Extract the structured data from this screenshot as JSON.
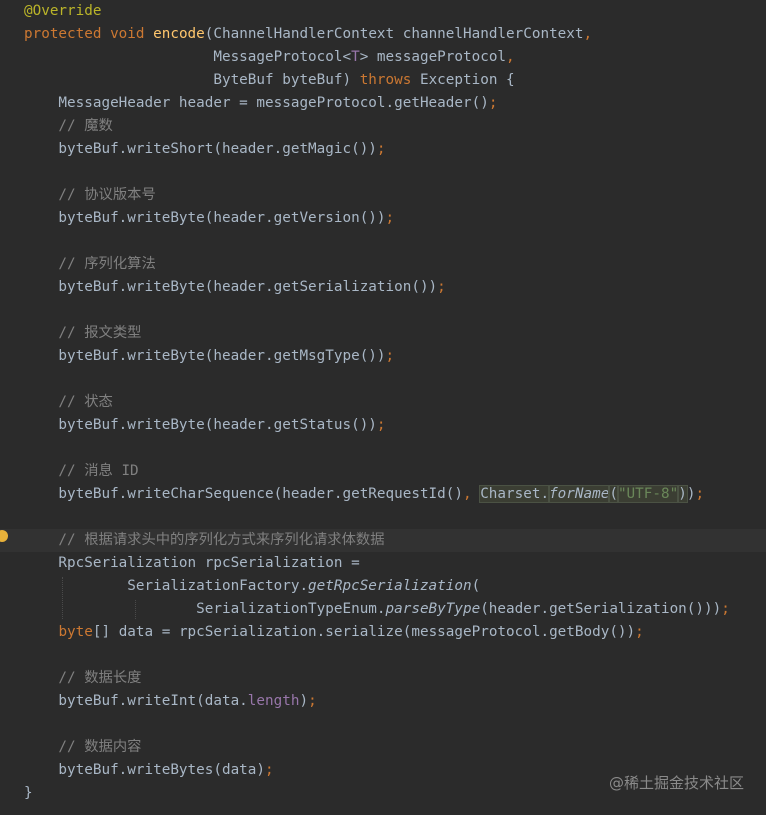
{
  "theme": {
    "background": "#2b2b2b",
    "text": "#a9b7c6",
    "keyword": "#cc7832",
    "annotation": "#bbb529",
    "method": "#ffc66d",
    "comment": "#808080",
    "string": "#6a8759",
    "field": "#9876aa"
  },
  "code_lines": [
    [
      {
        "text": "@Override",
        "cls": "ann"
      }
    ],
    [
      {
        "text": "protected ",
        "cls": "kw"
      },
      {
        "text": "void ",
        "cls": "kw"
      },
      {
        "text": "encode",
        "cls": "fn"
      },
      {
        "text": "(ChannelHandlerContext channelHandlerContext"
      },
      {
        "text": ",",
        "cls": "kw"
      }
    ],
    [
      {
        "text": "                      MessageProtocol<"
      },
      {
        "text": "T",
        "cls": "field"
      },
      {
        "text": "> messageProtocol"
      },
      {
        "text": ",",
        "cls": "kw"
      }
    ],
    [
      {
        "text": "                      ByteBuf byteBuf) "
      },
      {
        "text": "throws ",
        "cls": "kw"
      },
      {
        "text": "Exception {"
      }
    ],
    [
      {
        "text": "    MessageHeader header = messageProtocol.getHeader()"
      },
      {
        "text": ";",
        "cls": "kw"
      }
    ],
    [
      {
        "text": "    // 魔数",
        "cls": "cm"
      }
    ],
    [
      {
        "text": "    byteBuf.writeShort(header.getMagic())"
      },
      {
        "text": ";",
        "cls": "kw"
      }
    ],
    [],
    [
      {
        "text": "    // 协议版本号",
        "cls": "cm"
      }
    ],
    [
      {
        "text": "    byteBuf.writeByte(header.getVersion())"
      },
      {
        "text": ";",
        "cls": "kw"
      }
    ],
    [],
    [
      {
        "text": "    // 序列化算法",
        "cls": "cm"
      }
    ],
    [
      {
        "text": "    byteBuf.writeByte(header.getSerialization())"
      },
      {
        "text": ";",
        "cls": "kw"
      }
    ],
    [],
    [
      {
        "text": "    // 报文类型",
        "cls": "cm"
      }
    ],
    [
      {
        "text": "    byteBuf.writeByte(header.getMsgType())"
      },
      {
        "text": ";",
        "cls": "kw"
      }
    ],
    [],
    [
      {
        "text": "    // 状态",
        "cls": "cm"
      }
    ],
    [
      {
        "text": "    byteBuf.writeByte(header.getStatus())"
      },
      {
        "text": ";",
        "cls": "kw"
      }
    ],
    [],
    [
      {
        "text": "    // 消息 ID",
        "cls": "cm"
      }
    ],
    [
      {
        "text": "    byteBuf.writeCharSequence(header.getRequestId()"
      },
      {
        "text": ", ",
        "cls": "kw"
      },
      {
        "text": "Charset.",
        "cls": "box"
      },
      {
        "text": "forName",
        "cls": "it box"
      },
      {
        "text": "(",
        "cls": "box"
      },
      {
        "text": "\"UTF-8\"",
        "cls": "str box"
      },
      {
        "text": ")",
        "cls": "box"
      },
      {
        "text": ")"
      },
      {
        "text": ";",
        "cls": "kw"
      }
    ],
    [],
    [
      {
        "text": "    // 根据请求头中的序列化方式来序列化请求体数据",
        "cls": "cm"
      }
    ],
    [
      {
        "text": "    RpcSerialization rpcSerialization ="
      }
    ],
    [
      {
        "text": "            SerializationFactory."
      },
      {
        "text": "getRpcSerialization",
        "cls": "it"
      },
      {
        "text": "("
      }
    ],
    [
      {
        "text": "                    SerializationTypeEnum."
      },
      {
        "text": "parseByType",
        "cls": "it"
      },
      {
        "text": "(header.getSerialization()))"
      },
      {
        "text": ";",
        "cls": "kw"
      }
    ],
    [
      {
        "text": "    "
      },
      {
        "text": "byte",
        "cls": "kw"
      },
      {
        "text": "[] data = rpcSerialization.serialize(messageProtocol.getBody())"
      },
      {
        "text": ";",
        "cls": "kw"
      }
    ],
    [],
    [
      {
        "text": "    // 数据长度",
        "cls": "cm"
      }
    ],
    [
      {
        "text": "    byteBuf.writeInt(data."
      },
      {
        "text": "length",
        "cls": "field"
      },
      {
        "text": ")"
      },
      {
        "text": ";",
        "cls": "kw"
      }
    ],
    [],
    [
      {
        "text": "    // 数据内容",
        "cls": "cm"
      }
    ],
    [
      {
        "text": "    byteBuf.writeBytes(data)"
      },
      {
        "text": ";",
        "cls": "kw"
      }
    ],
    [
      {
        "text": "}"
      }
    ]
  ],
  "highlighted_line": 23,
  "watermark": "@稀土掘金技术社区",
  "icons": {
    "gutter": "bulb-icon"
  }
}
